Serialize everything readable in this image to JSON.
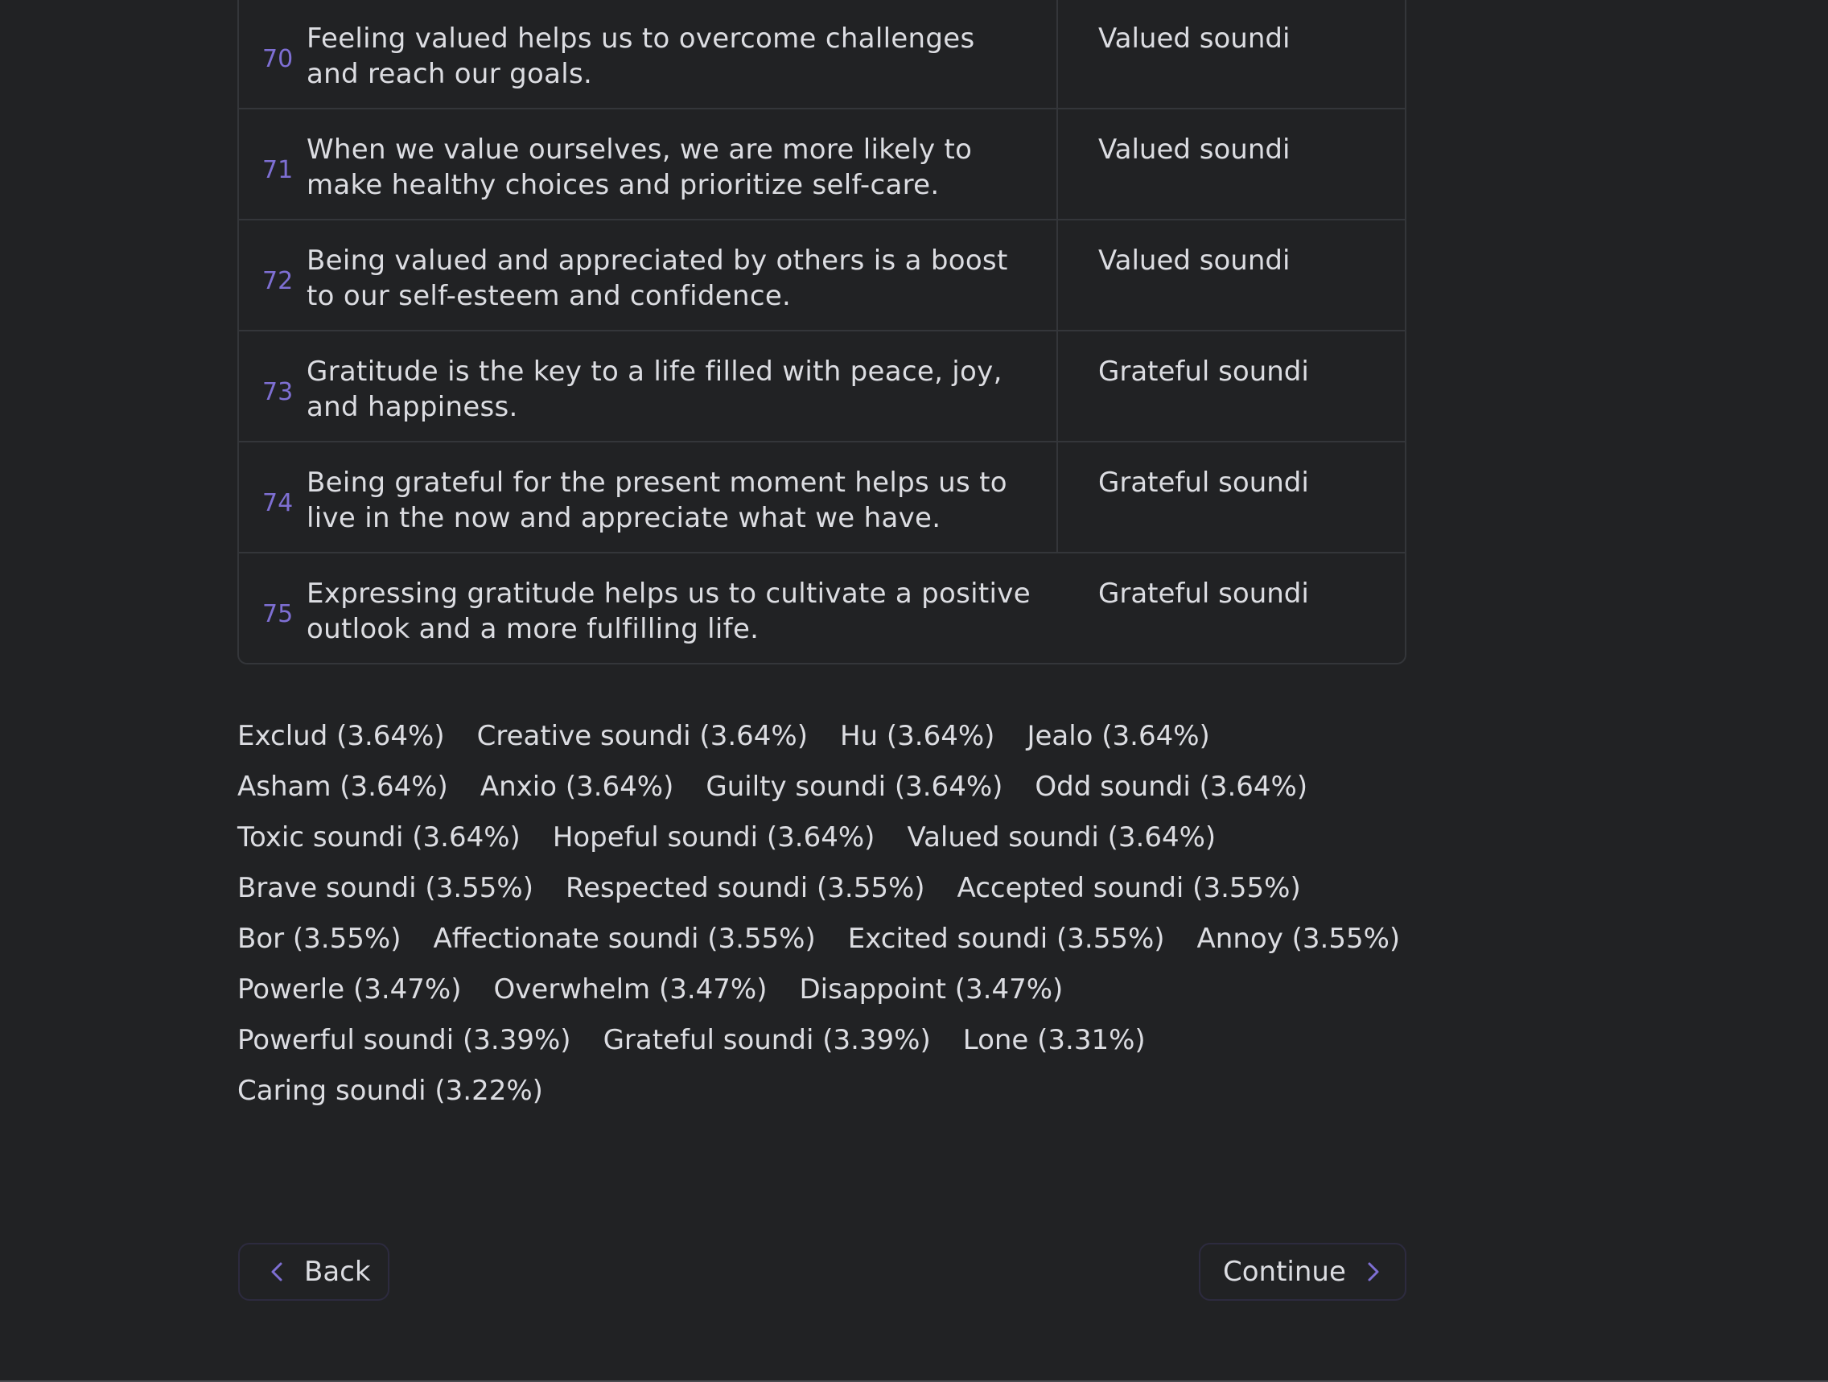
{
  "table": {
    "rows": [
      {
        "num": "70",
        "text": "Feeling valued helps us to overcome challenges and reach our goals.",
        "label": "Valued soundi"
      },
      {
        "num": "71",
        "text": "When we value ourselves, we are more likely to make healthy choices and prioritize self-care.",
        "label": "Valued soundi"
      },
      {
        "num": "72",
        "text": "Being valued and appreciated by others is a boost to our self-esteem and confidence.",
        "label": "Valued soundi"
      },
      {
        "num": "73",
        "text": "Gratitude is the key to a life filled with peace, joy, and happiness.",
        "label": "Grateful soundi"
      },
      {
        "num": "74",
        "text": "Being grateful for the present moment helps us to live in the now and appreciate what we have.",
        "label": "Grateful soundi"
      },
      {
        "num": "75",
        "text": "Expressing gratitude helps us to cultivate a positive outlook and a more fulfilling life.",
        "label": "Grateful soundi"
      }
    ]
  },
  "stats": {
    "lines": [
      [
        "Exclud (3.64%)",
        "Creative soundi (3.64%)",
        "Hu (3.64%)",
        "Jealo (3.64%)"
      ],
      [
        "Asham (3.64%)",
        "Anxio (3.64%)",
        "Guilty soundi (3.64%)",
        "Odd soundi (3.64%)"
      ],
      [
        "Toxic soundi (3.64%)",
        "Hopeful soundi (3.64%)",
        "Valued soundi (3.64%)"
      ],
      [
        "Brave soundi (3.55%)",
        "Respected soundi (3.55%)",
        "Accepted soundi (3.55%)"
      ],
      [
        "Bor (3.55%)",
        "Affectionate soundi (3.55%)",
        "Excited soundi (3.55%)",
        "Annoy (3.55%)"
      ],
      [
        "Powerle (3.47%)",
        "Overwhelm (3.47%)",
        "Disappoint (3.47%)"
      ],
      [
        "Powerful soundi (3.39%)",
        "Grateful soundi (3.39%)",
        "Lone (3.31%)"
      ],
      [
        "Caring soundi (3.22%)"
      ]
    ]
  },
  "nav": {
    "back_label": "Back",
    "back_icon": "chevron-left-icon",
    "continue_label": "Continue",
    "continue_icon": "chevron-right-icon"
  },
  "colors": {
    "background": "#212224",
    "accent": "#7e6fd3",
    "text": "#dcdde2",
    "border": "#34363a"
  }
}
